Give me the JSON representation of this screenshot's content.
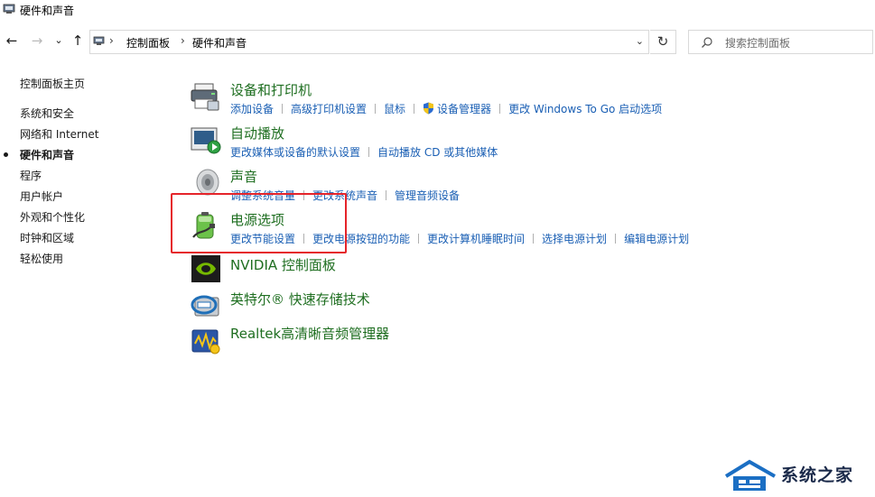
{
  "window": {
    "title": "硬件和声音"
  },
  "nav": {
    "back": "←",
    "forward": "→",
    "recent": "⌄",
    "up": "↑",
    "breadcrumb": [
      "控制面板",
      "硬件和声音"
    ],
    "dropdown": "⌄",
    "refresh": "↻",
    "search_placeholder": "搜索控制面板"
  },
  "sidebar": {
    "items": [
      {
        "label": "控制面板主页",
        "current": false
      },
      {
        "label": "系统和安全",
        "current": false
      },
      {
        "label": "网络和 Internet",
        "current": false
      },
      {
        "label": "硬件和声音",
        "current": true
      },
      {
        "label": "程序",
        "current": false
      },
      {
        "label": "用户帐户",
        "current": false
      },
      {
        "label": "外观和个性化",
        "current": false
      },
      {
        "label": "时钟和区域",
        "current": false
      },
      {
        "label": "轻松使用",
        "current": false
      }
    ]
  },
  "categories": [
    {
      "title": "设备和打印机",
      "icon": "printer-icon",
      "links": [
        "添加设备",
        "高级打印机设置",
        "鼠标",
        "设备管理器",
        "更改 Windows To Go 启动选项"
      ]
    },
    {
      "title": "自动播放",
      "icon": "autoplay-icon",
      "links": [
        "更改媒体或设备的默认设置",
        "自动播放 CD 或其他媒体"
      ]
    },
    {
      "title": "声音",
      "icon": "speaker-icon",
      "links": [
        "调整系统音量",
        "更改系统声音",
        "管理音频设备"
      ]
    },
    {
      "title": "电源选项",
      "icon": "battery-icon",
      "links": [
        "更改节能设置",
        "更改电源按钮的功能",
        "更改计算机睡眠时间",
        "选择电源计划",
        "编辑电源计划"
      ]
    },
    {
      "title": "NVIDIA 控制面板",
      "icon": "nvidia-icon",
      "links": []
    },
    {
      "title": "英特尔® 快速存储技术",
      "icon": "intel-storage-icon",
      "links": []
    },
    {
      "title": "Realtek高清晰音频管理器",
      "icon": "realtek-audio-icon",
      "links": []
    }
  ],
  "colors": {
    "category_title": "#1e6e20",
    "link": "#1a5fb4",
    "highlight_box": "#e5242a"
  },
  "watermark": {
    "text": "系统之家"
  }
}
